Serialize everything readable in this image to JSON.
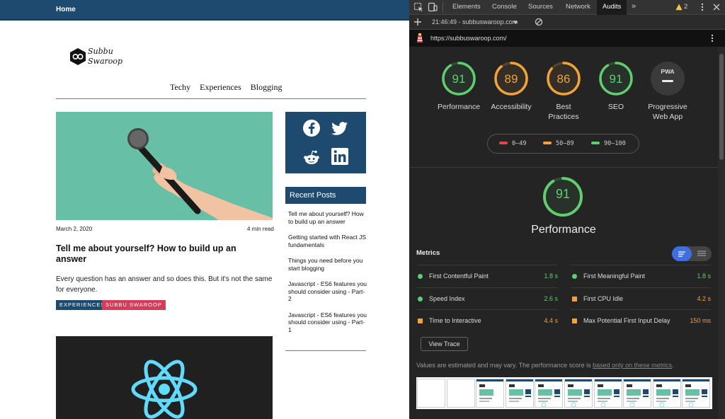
{
  "site": {
    "nav_home": "Home",
    "logo": {
      "line1": "Subbu",
      "line2": "Swaroop"
    },
    "menu": [
      "Techy",
      "Experiences",
      "Blogging"
    ],
    "post": {
      "date": "March 2, 2020",
      "read_time": "4 min read",
      "title": "Tell me about yourself? How to build up an answer",
      "excerpt": "Every question has an answer and so does this. But it's not the same for everyone.",
      "tags": [
        "EXPERIENCES",
        "SUBBU SWAROOP"
      ]
    },
    "social_icons": [
      "facebook-icon",
      "twitter-icon",
      "reddit-icon",
      "linkedin-icon"
    ],
    "recent_posts": {
      "heading": "Recent Posts",
      "items": [
        "Tell me about yourself? How to build up an answer",
        "Getting started with React JS fundamentals",
        "Things you need before you start blogging",
        "Javascript - ES6 features you should consider using - Part-2",
        "Javascript - ES6 features you should consider using - Part-1"
      ]
    }
  },
  "devtools": {
    "tabs": [
      "Elements",
      "Console",
      "Sources",
      "Network",
      "Audits"
    ],
    "active_tab": "Audits",
    "more_tabs": "»",
    "warning_count": "2",
    "session": "21:46:49 - subbuswaroop.com",
    "url": "https://subbuswaroop.com/",
    "scores": [
      {
        "label": "Performance",
        "value": "91",
        "color": "#5fce6e"
      },
      {
        "label": "Accessibility",
        "value": "89",
        "color": "#f0a33a"
      },
      {
        "label": "Best Practices",
        "value": "86",
        "color": "#f0a33a"
      },
      {
        "label": "SEO",
        "value": "91",
        "color": "#5fce6e"
      },
      {
        "label": "Progressive Web App",
        "value": "PWA",
        "color": "#777"
      }
    ],
    "legend": [
      {
        "range": "0–49",
        "color": "#e0484e"
      },
      {
        "range": "50–89",
        "color": "#f0a33a"
      },
      {
        "range": "90–100",
        "color": "#5fce6e"
      }
    ],
    "performance": {
      "score": "91",
      "title": "Performance"
    },
    "metrics_heading": "Metrics",
    "metrics": [
      {
        "name": "First Contentful Paint",
        "value": "1.8 s",
        "status": "good"
      },
      {
        "name": "First Meaningful Paint",
        "value": "1.8 s",
        "status": "good"
      },
      {
        "name": "Speed Index",
        "value": "2.6 s",
        "status": "good"
      },
      {
        "name": "First CPU Idle",
        "value": "4.2 s",
        "status": "average"
      },
      {
        "name": "Time to Interactive",
        "value": "4.4 s",
        "status": "average"
      },
      {
        "name": "Max Potential First Input Delay",
        "value": "150 ms",
        "status": "average"
      }
    ],
    "view_trace": "View Trace",
    "note_text": "Values are estimated and may vary. The performance score is ",
    "note_link": "based only on these metrics",
    "note_end": ".",
    "colors": {
      "good": "#5fce6e",
      "average": "#f0a33a",
      "poor": "#e0484e",
      "accent": "#3e6fe0"
    }
  }
}
